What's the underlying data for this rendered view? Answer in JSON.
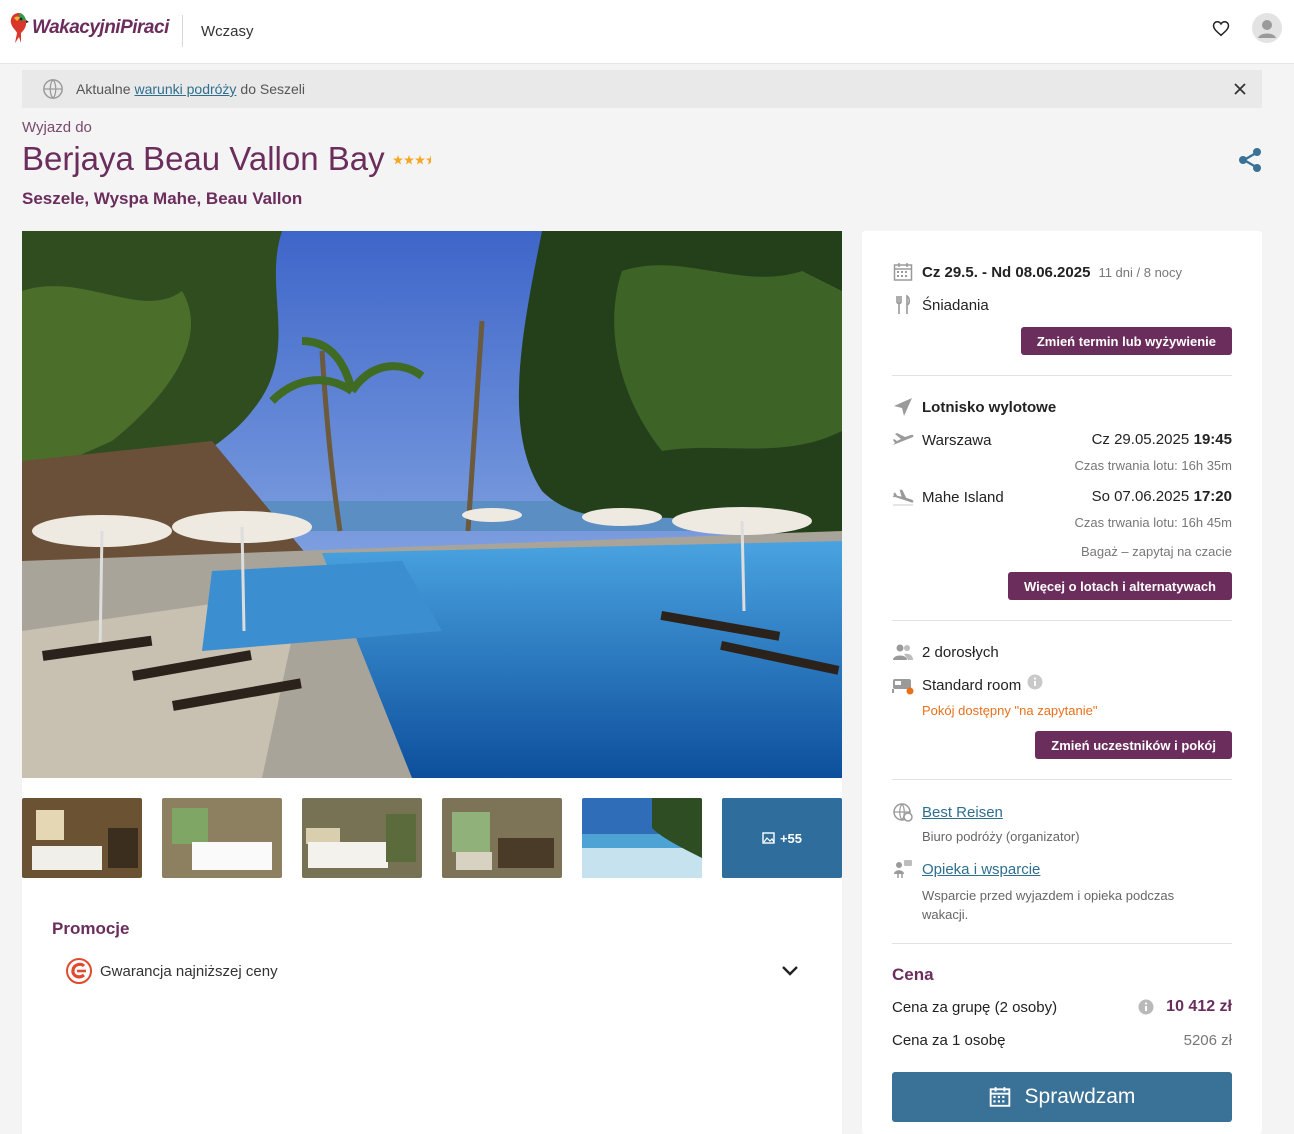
{
  "header": {
    "logo_text": "WakacyjniPiraci",
    "nav_label": "Wczasy"
  },
  "notice": {
    "prefix": "Aktualne",
    "link": "warunki podróży",
    "suffix": "do Seszeli"
  },
  "hotel": {
    "eyebrow": "Wyjazd do",
    "name": "Berjaya Beau Vallon Bay",
    "stars": 3.5,
    "location": "Seszele, Wyspa Mahe, Beau Vallon"
  },
  "gallery": {
    "more_label": "+55"
  },
  "promo": {
    "title": "Promocje",
    "item": "Gwarancja najniższej ceny"
  },
  "booking": {
    "dates": "Cz 29.5. - Nd 08.06.2025",
    "duration": "11 dni / 8 nocy",
    "board": "Śniadania",
    "change_term_btn": "Zmień termin lub wyżywienie",
    "airport_title": "Lotnisko wylotowe",
    "outbound": {
      "city": "Warszawa",
      "date": "Cz 29.05.2025",
      "time": "19:45",
      "duration": "Czas trwania lotu: 16h 35m"
    },
    "inbound": {
      "city": "Mahe Island",
      "date": "So 07.06.2025",
      "time": "17:20",
      "duration": "Czas trwania lotu: 16h 45m"
    },
    "baggage": "Bagaż – zapytaj na czacie",
    "flights_btn": "Więcej o lotach i alternatywach",
    "travellers": "2 dorosłych",
    "room": "Standard room",
    "room_status": "Pokój dostępny \"na zapytanie\"",
    "change_room_btn": "Zmień uczestników i pokój",
    "organizer_link": "Best Reisen",
    "organizer_desc": "Biuro podróży (organizator)",
    "support_link": "Opieka i wsparcie",
    "support_desc": "Wsparcie przed wyjazdem i opieka podczas wakacji."
  },
  "price": {
    "title": "Cena",
    "group_label": "Cena za grupę (2 osoby)",
    "group_value": "10 412 zł",
    "person_label": "Cena za 1 osobę",
    "person_value": "5206 zł",
    "cta": "Sprawdzam"
  },
  "colors": {
    "brand": "#6b2d5c",
    "link": "#2e6f8e",
    "cta": "#3a7196",
    "warning": "#e8701a",
    "star": "#f5a623"
  }
}
